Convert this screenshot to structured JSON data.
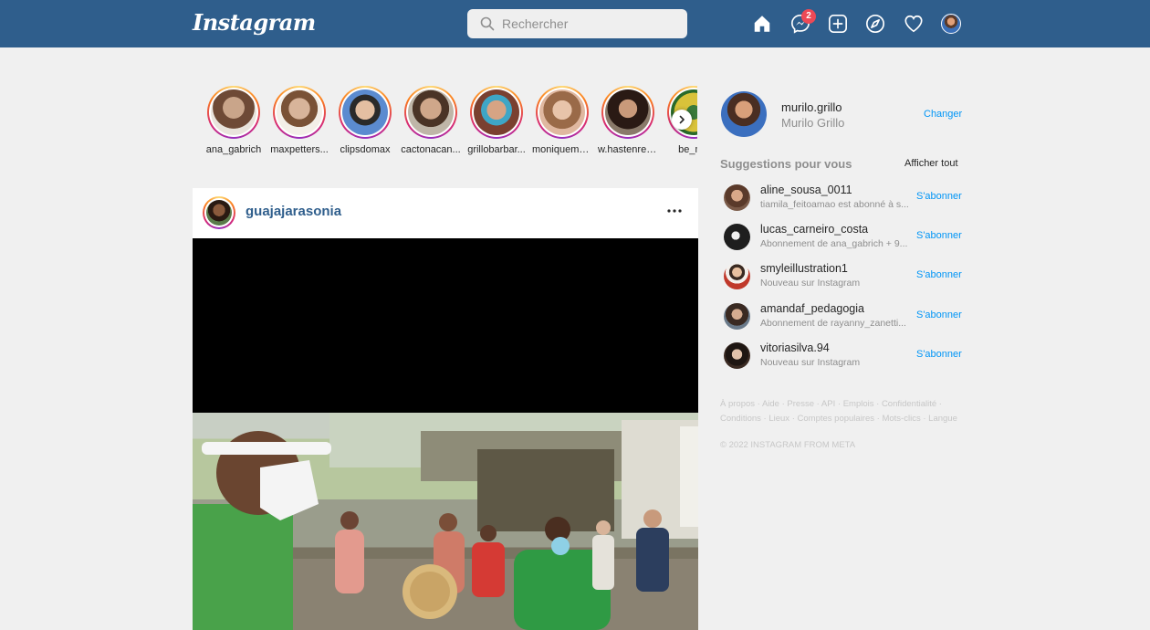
{
  "header": {
    "logo": "Instagram",
    "search_placeholder": "Rechercher",
    "messenger_badge": "2"
  },
  "stories": [
    {
      "username": "ana_gabrich",
      "pic": "#c9a58a"
    },
    {
      "username": "maxpetters...",
      "pic": "#d8b49a"
    },
    {
      "username": "clipsdomax",
      "pic": "#5b8bd0"
    },
    {
      "username": "cactonacan...",
      "pic": "#bfa18a"
    },
    {
      "username": "grillobarbar...",
      "pic": "#7a4030"
    },
    {
      "username": "moniquema...",
      "pic": "#e0b8a0"
    },
    {
      "username": "w.hastenreit...",
      "pic": "#5a3a2e"
    },
    {
      "username": "be_ma",
      "pic": "#d9c23a"
    }
  ],
  "post": {
    "username": "guajajarasonia"
  },
  "profile": {
    "username": "murilo.grillo",
    "fullname": "Murilo Grillo",
    "switch_label": "Changer"
  },
  "suggestions": {
    "title": "Suggestions pour vous",
    "see_all": "Afficher tout",
    "follow_label": "S'abonner",
    "items": [
      {
        "username": "aline_sousa_0011",
        "subtitle": "tiamila_feitoamao est abonné à s...",
        "pic": "#7a5a48"
      },
      {
        "username": "lucas_carneiro_costa",
        "subtitle": "Abonnement de ana_gabrich + 9...",
        "pic": "#1e1e1e"
      },
      {
        "username": "smyleillustration1",
        "subtitle": "Nouveau sur Instagram",
        "pic": "#c0392b"
      },
      {
        "username": "amandaf_pedagogia",
        "subtitle": "Abonnement de rayanny_zanetti...",
        "pic": "#6a7a8a"
      },
      {
        "username": "vitoriasilva.94",
        "subtitle": "Nouveau sur Instagram",
        "pic": "#3a2a22"
      }
    ]
  },
  "footer": {
    "links": [
      "À propos",
      "Aide",
      "Presse",
      "API",
      "Emplois",
      "Confidentialité",
      "Conditions",
      "Lieux",
      "Comptes populaires",
      "Mots-clics",
      "Langue"
    ],
    "copyright": "© 2022 INSTAGRAM FROM META"
  },
  "colors": {
    "header_bg": "#2f5e8c",
    "link_blue": "#0095f6",
    "badge_red": "#ed4956"
  },
  "icons": [
    "search-icon",
    "home-icon",
    "messenger-icon",
    "new-post-icon",
    "explore-icon",
    "heart-icon",
    "chevron-right-icon",
    "more-icon"
  ]
}
